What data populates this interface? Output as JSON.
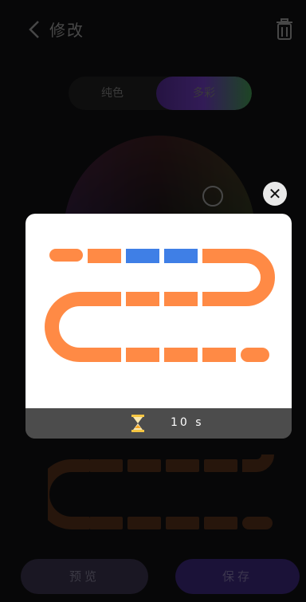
{
  "header": {
    "title": "修改"
  },
  "mode_toggle": {
    "options": [
      "纯色",
      "多彩"
    ],
    "selected": "多彩"
  },
  "effect_dialog": {
    "duration": "10 s",
    "close_icon": "close-icon",
    "timer_icon": "hourglass-icon",
    "led_strip": {
      "segments_total": 20,
      "highlight_color": "#3f7fe6",
      "base_color": "#ff8a45",
      "highlighted_segments": [
        2,
        3
      ]
    }
  },
  "footer": {
    "preview_label": "预览",
    "save_label": "保存"
  },
  "colors": {
    "accent_purple": "#2a1c56",
    "led_orange": "#ff8a45",
    "led_blue": "#3f7fe6"
  }
}
